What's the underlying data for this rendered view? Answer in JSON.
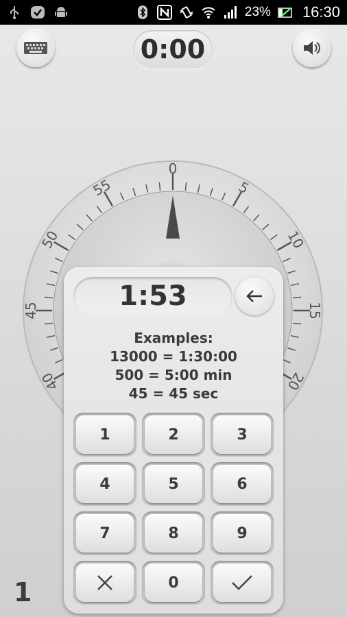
{
  "status_bar": {
    "battery": "23%",
    "time": "16:30",
    "left_icons": [
      "usb-icon",
      "check-icon",
      "android-icon"
    ],
    "right_icons": [
      "bluetooth-icon",
      "nfc-icon",
      "vibrate-icon",
      "wifi-icon",
      "signal-icon",
      "battery-icon"
    ]
  },
  "header": {
    "elapsed_time": "0:00",
    "left_button_icon": "keyboard-icon",
    "right_button_icon": "volume-icon"
  },
  "dial": {
    "labels": [
      "0",
      "5",
      "10",
      "15",
      "20",
      "40",
      "45",
      "50",
      "55"
    ],
    "pointer_value": 0
  },
  "keypad": {
    "input_value": "1:53",
    "backspace_icon": "backspace-arrow-icon",
    "examples": [
      "Examples:",
      "13000 = 1:30:00",
      "500 = 5:00 min",
      "45 = 45 sec"
    ],
    "keys": [
      "1",
      "2",
      "3",
      "4",
      "5",
      "6",
      "7",
      "8",
      "9"
    ],
    "zero": "0",
    "cancel_icon": "close-icon",
    "confirm_icon": "check-icon"
  },
  "corner_counter": "1"
}
